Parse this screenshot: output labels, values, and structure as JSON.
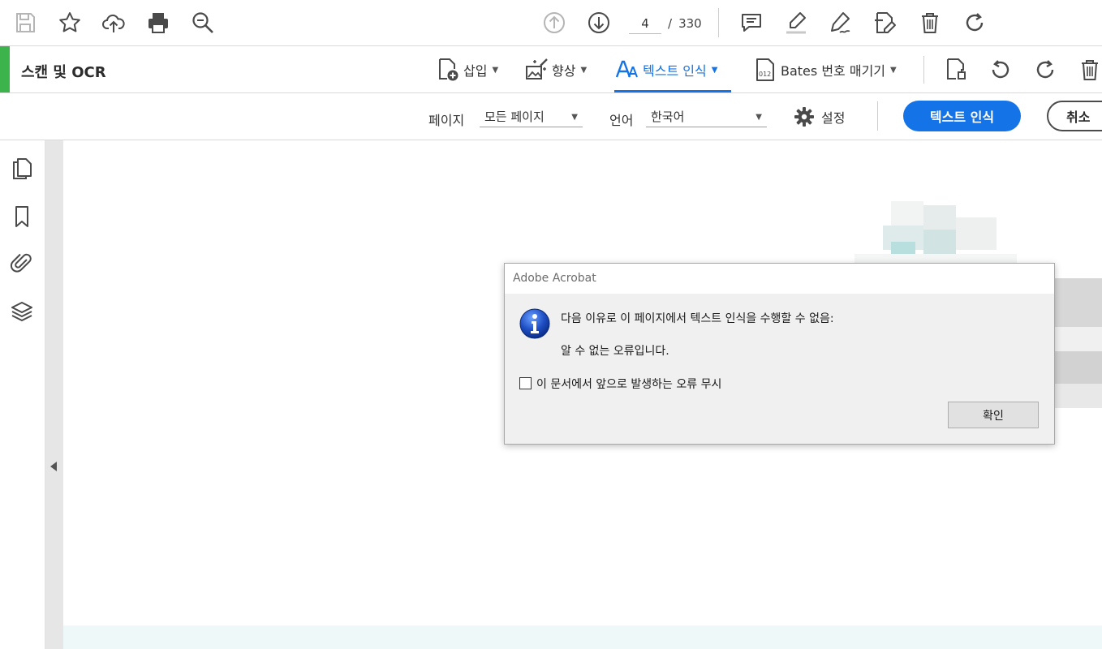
{
  "top_toolbar": {
    "icons": [
      "save-icon",
      "star-icon",
      "cloud-upload-icon",
      "print-icon",
      "zoom-search-icon",
      "page-up-icon",
      "page-down-icon",
      "comment-icon",
      "highlight-icon",
      "sign-icon",
      "edit-pdf-icon",
      "delete-icon",
      "rotate-icon"
    ],
    "current_page": "4",
    "page_separator": "/",
    "total_pages": "330"
  },
  "tool_bar": {
    "title": "스캔 및 OCR",
    "accent_color": "#3cb44b",
    "menus": [
      {
        "label": "삽입",
        "icon": "insert-page-icon"
      },
      {
        "label": "향상",
        "icon": "enhance-icon"
      },
      {
        "label": "텍스트 인식",
        "icon": "text-recognition-icon",
        "active": true
      },
      {
        "label": "Bates 번호 매기기",
        "icon": "bates-number-icon"
      }
    ],
    "right_icons": [
      "page-replace-icon",
      "rotate-left-icon",
      "rotate-right-icon",
      "trash-icon"
    ]
  },
  "options_bar": {
    "page_label": "페이지",
    "page_value": "모든 페이지",
    "language_label": "언어",
    "language_value": "한국어",
    "settings_label": "설정",
    "recognize_button": "텍스트 인식",
    "cancel_button": "취소",
    "accent_color": "#1473e6"
  },
  "left_nav": {
    "icons": [
      "pages-icon",
      "bookmark-icon",
      "attachment-icon",
      "layers-icon"
    ]
  },
  "dialog": {
    "title": "Adobe Acrobat",
    "message_line1": "다음 이유로 이 페이지에서 텍스트 인식을 수행할 수 없음:",
    "message_line2": "알 수 없는 오류입니다.",
    "checkbox_label": "이 문서에서 앞으로 발생하는 오류 무시",
    "checkbox_checked": false,
    "ok_button": "확인"
  }
}
